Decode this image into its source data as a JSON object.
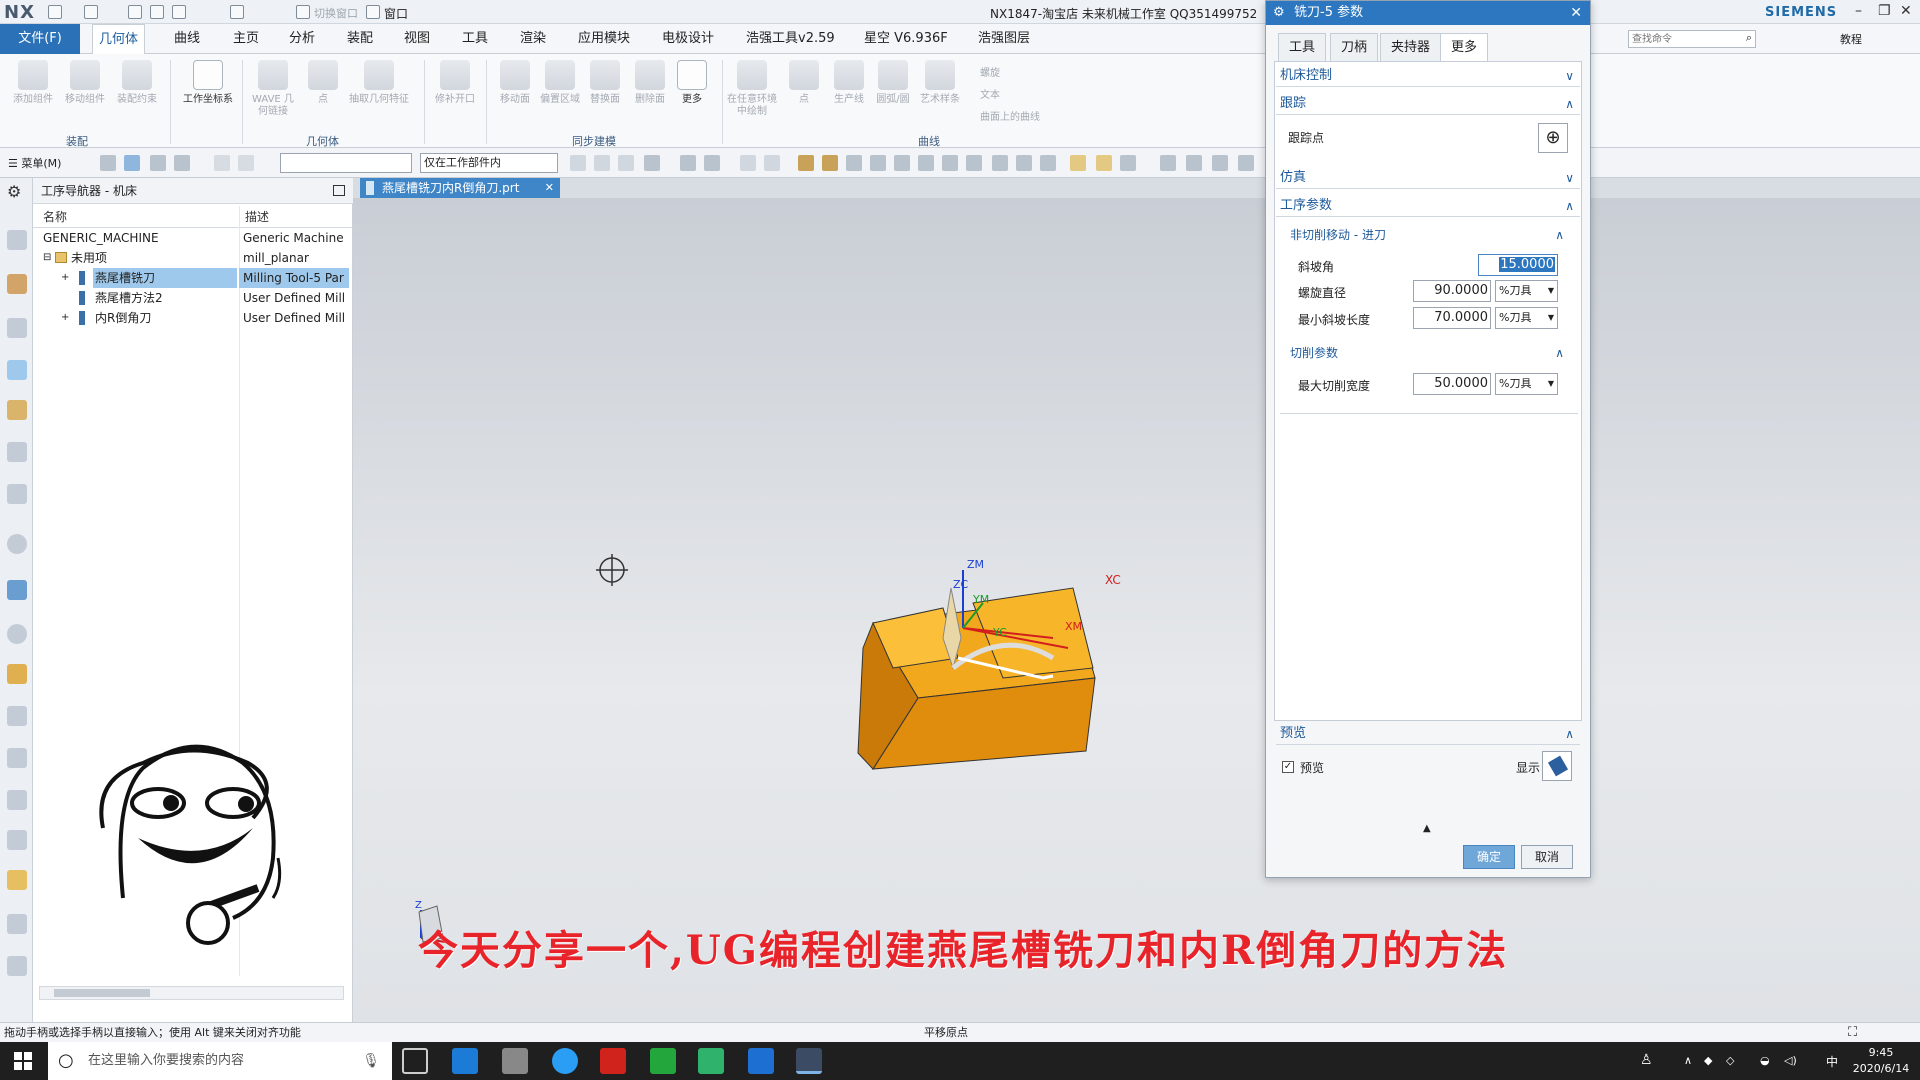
{
  "window": {
    "logo": "NX",
    "title": "NX1847-淘宝店  未来机械工作室  QQ351499752",
    "brand": "SIEMENS",
    "window_menu": "窗口",
    "switch_window": "切换窗口",
    "search_placeholder": "查找命令",
    "help_label": "教程"
  },
  "menu": {
    "file": "文件(F)",
    "tabs": [
      "几何体",
      "曲线",
      "主页",
      "分析",
      "装配",
      "视图",
      "工具",
      "渲染",
      "应用模块",
      "电极设计",
      "浩强工具v2.59",
      "星空 V6.936F",
      "浩强图层"
    ],
    "active": "几何体"
  },
  "ribbon": {
    "buttons": [
      "添加组件",
      "移动组件",
      "装配约束",
      "工作坐标系",
      "WAVE 几何链接",
      "点",
      "抽取几何特征",
      "修补开口",
      "移动面",
      "偏置区域",
      "替换面",
      "删除面",
      "更多",
      "在任意环境中绘制",
      "点",
      "生产线",
      "圆弧/圆",
      "艺术样条"
    ],
    "small": [
      "螺旋",
      "文本",
      "曲面上的曲线"
    ],
    "groups": [
      "装配",
      "几何体",
      "同步建模",
      "曲线"
    ]
  },
  "toolbar2": {
    "menu_label": "菜单(M)",
    "filter_value": "",
    "scope_value": "仅在工作部件内"
  },
  "navigator": {
    "title": "工序导航器 - 机床",
    "col_name": "名称",
    "col_desc": "描述",
    "rows": [
      {
        "name": "GENERIC_MACHINE",
        "desc": "Generic Machine"
      },
      {
        "name": "未用项",
        "desc": "mill_planar"
      },
      {
        "name": "燕尾槽铣刀",
        "desc": "Milling Tool-5 Par"
      },
      {
        "name": "燕尾槽方法2",
        "desc": "User Defined Mill"
      },
      {
        "name": "内R倒角刀",
        "desc": "User Defined Mill"
      }
    ]
  },
  "document": {
    "tab": "燕尾槽铣刀内R倒角刀.prt"
  },
  "viewport": {
    "axes": {
      "zm": "ZM",
      "zc": "ZC",
      "ym": "YM",
      "yc": "YC",
      "xm": "XM",
      "xc": "XC",
      "z": "Z"
    },
    "caption": "今天分享一个,UG编程创建燕尾槽铣刀和内R倒角刀的方法"
  },
  "dialog": {
    "title": "铣刀-5 参数",
    "tabs": [
      "工具",
      "刀柄",
      "夹持器",
      "更多"
    ],
    "active_tab": "更多",
    "sections": {
      "machine_control": "机床控制",
      "tracking": "跟踪",
      "tracking_point": "跟踪点",
      "simulation": "仿真",
      "operation_params": "工序参数",
      "non_cutting": "非切削移动 - 进刀",
      "ramp_angle_label": "斜坡角",
      "ramp_angle": "15.0000",
      "helix_dia_label": "螺旋直径",
      "helix_dia": "90.0000",
      "helix_unit": "%刀具",
      "min_ramp_label": "最小斜坡长度",
      "min_ramp": "70.0000",
      "min_ramp_unit": "%刀具",
      "cut_params": "切削参数",
      "max_cut_width_label": "最大切削宽度",
      "max_cut_width": "50.0000",
      "max_cut_width_unit": "%刀具",
      "preview": "预览",
      "preview_check": "预览",
      "show_label": "显示"
    },
    "ok": "确定",
    "cancel": "取消"
  },
  "status": {
    "left": "拖动手柄或选择手柄以直接输入；使用 Alt 键来关闭对齐功能",
    "center": "平移原点"
  },
  "taskbar": {
    "search": "在这里输入你要搜索的内容",
    "time": "9:45",
    "date": "2020/6/14",
    "ime": "中"
  }
}
